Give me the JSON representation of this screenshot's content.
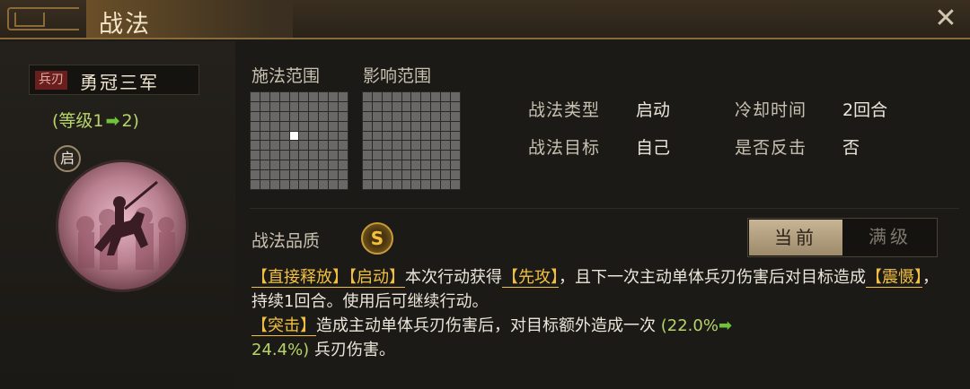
{
  "title": "战法",
  "close_icon": "close-icon",
  "skill": {
    "type_badge": "兵刃",
    "name": "勇冠三军",
    "level_prefix": "(等级1",
    "level_arrow": "➡",
    "level_suffix": "2)",
    "portrait_badge": "启"
  },
  "range": {
    "cast_label": "施法范围",
    "effect_label": "影响范围"
  },
  "info": {
    "type_label": "战法类型",
    "type_value": "启动",
    "cooldown_label": "冷却时间",
    "cooldown_value": "2回合",
    "target_label": "战法目标",
    "target_value": "自己",
    "counter_label": "是否反击",
    "counter_value": "否"
  },
  "quality": {
    "label": "战法品质",
    "grade": "S"
  },
  "toggle": {
    "current": "当前",
    "max": "满级"
  },
  "description": {
    "tag1": "【直接释放】",
    "tag2": "【启动】",
    "t1": "本次行动获得",
    "tag3": "【先攻】",
    "t2": "，且下一次主动单体兵刃伤害后对目标造成",
    "tag4": "【震慑】",
    "t3": "，持续1回合。使用后可继续行动。",
    "tag5": "【突击】",
    "t4": "造成主动单体兵刃伤害后，对目标额外造成一次",
    "g1": "(22.0%",
    "garrow": "➡",
    "g2": "24.4%)",
    "t5": "兵刃伤害。"
  }
}
